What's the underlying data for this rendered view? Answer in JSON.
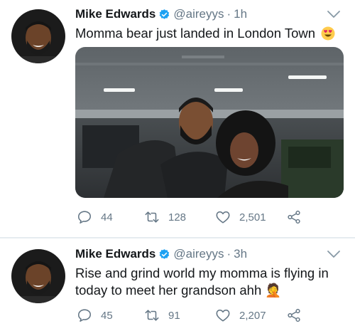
{
  "tweets": [
    {
      "author": "Mike Edwards",
      "handle": "@aireyys",
      "separator": "·",
      "time": "1h",
      "text": "Momma bear just landed in London Town",
      "replies": "44",
      "retweets": "128",
      "likes": "2,501"
    },
    {
      "author": "Mike Edwards",
      "handle": "@aireyys",
      "separator": "·",
      "time": "3h",
      "text": "Rise and grind world my momma is flying in today to meet her grandson ahh 🤦",
      "replies": "45",
      "retweets": "91",
      "likes": "2,207"
    }
  ],
  "icons": {
    "verified": "verified-badge-icon",
    "caret": "chevron-down-icon",
    "emoji": "heart-eyes-emoji-icon",
    "reply": "reply-icon",
    "retweet": "retweet-icon",
    "like": "heart-icon",
    "share": "share-icon"
  },
  "colors": {
    "verified": "#1da1f2",
    "secondary_text": "#657786",
    "primary_text": "#14171a",
    "divider": "#e6ecf0"
  }
}
